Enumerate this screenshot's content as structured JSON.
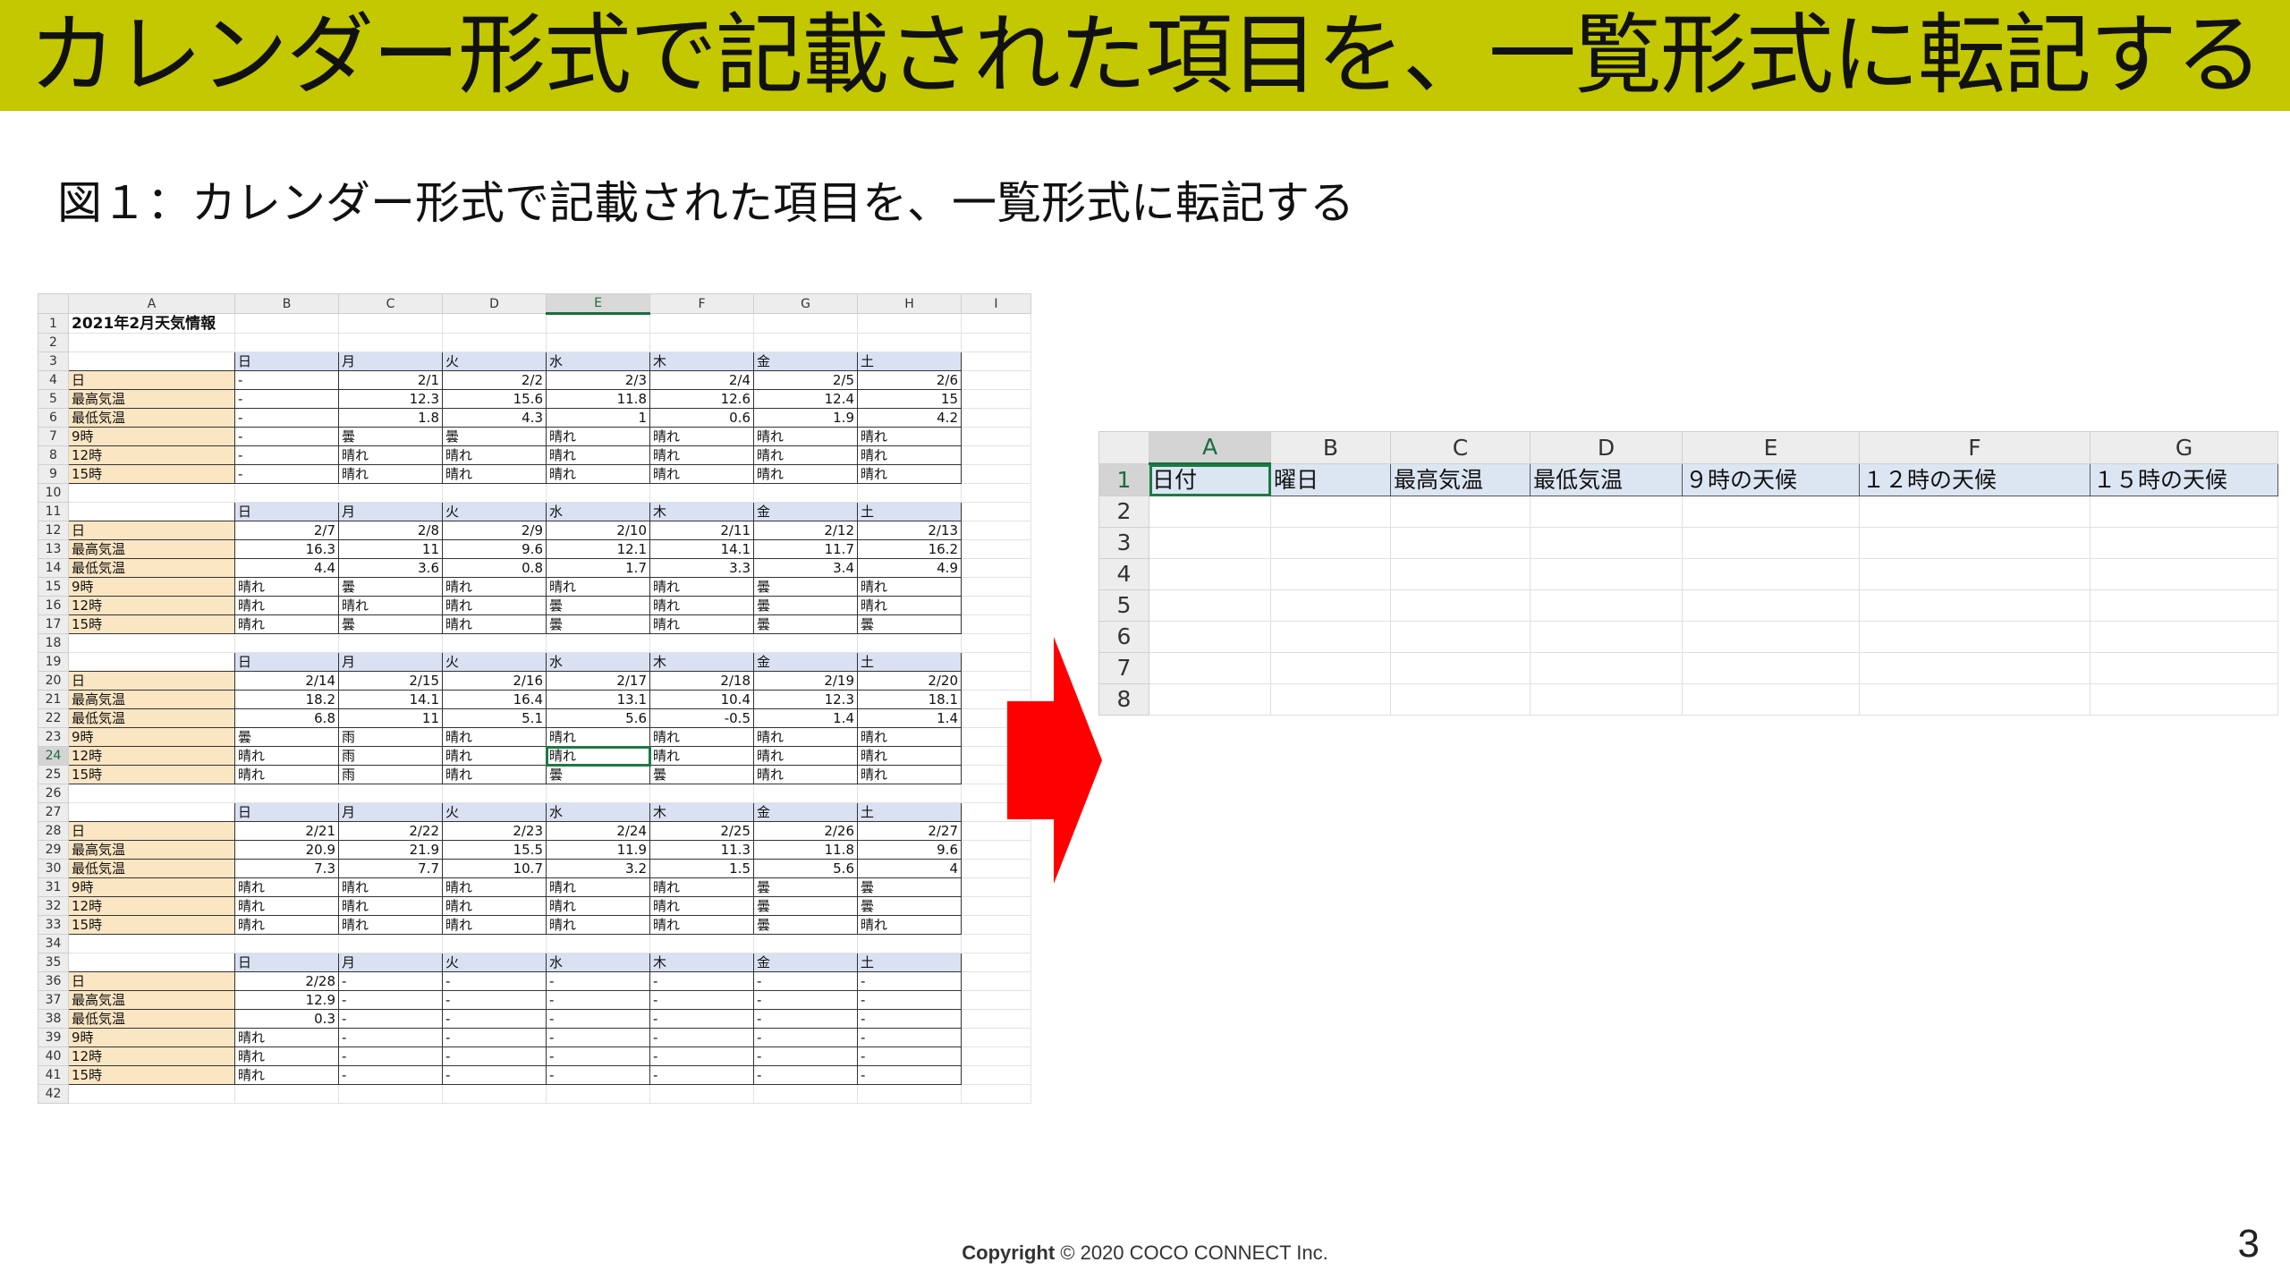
{
  "banner": {
    "title": "カレンダー形式で記載された項目を、一覧形式に転記する",
    "color": "#c3c800"
  },
  "caption": "図１：カレンダー形式で記載された項目を、一覧形式に転記する",
  "left_sheet": {
    "columns": [
      "A",
      "B",
      "C",
      "D",
      "E",
      "F",
      "G",
      "H",
      "I"
    ],
    "selected_column": "E",
    "selected_row": 24,
    "title": "2021年2月天気情報",
    "weekdays": [
      "日",
      "月",
      "火",
      "水",
      "木",
      "金",
      "土"
    ],
    "row_labels": [
      "日",
      "最高気温",
      "最低気温",
      "9時",
      "12時",
      "15時"
    ],
    "weeks": [
      {
        "dates": [
          "-",
          "2/1",
          "2/2",
          "2/3",
          "2/4",
          "2/5",
          "2/6"
        ],
        "high": [
          "-",
          "12.3",
          "15.6",
          "11.8",
          "12.6",
          "12.4",
          "15"
        ],
        "low": [
          "-",
          "1.8",
          "4.3",
          "1",
          "0.6",
          "1.9",
          "4.2"
        ],
        "w9": [
          "-",
          "曇",
          "曇",
          "晴れ",
          "晴れ",
          "晴れ",
          "晴れ"
        ],
        "w12": [
          "-",
          "晴れ",
          "晴れ",
          "晴れ",
          "晴れ",
          "晴れ",
          "晴れ"
        ],
        "w15": [
          "-",
          "晴れ",
          "晴れ",
          "晴れ",
          "晴れ",
          "晴れ",
          "晴れ"
        ]
      },
      {
        "dates": [
          "2/7",
          "2/8",
          "2/9",
          "2/10",
          "2/11",
          "2/12",
          "2/13"
        ],
        "high": [
          "16.3",
          "11",
          "9.6",
          "12.1",
          "14.1",
          "11.7",
          "16.2"
        ],
        "low": [
          "4.4",
          "3.6",
          "0.8",
          "1.7",
          "3.3",
          "3.4",
          "4.9"
        ],
        "w9": [
          "晴れ",
          "曇",
          "晴れ",
          "晴れ",
          "晴れ",
          "曇",
          "晴れ"
        ],
        "w12": [
          "晴れ",
          "晴れ",
          "晴れ",
          "曇",
          "晴れ",
          "曇",
          "晴れ"
        ],
        "w15": [
          "晴れ",
          "曇",
          "晴れ",
          "曇",
          "晴れ",
          "曇",
          "曇"
        ]
      },
      {
        "dates": [
          "2/14",
          "2/15",
          "2/16",
          "2/17",
          "2/18",
          "2/19",
          "2/20"
        ],
        "high": [
          "18.2",
          "14.1",
          "16.4",
          "13.1",
          "10.4",
          "12.3",
          "18.1"
        ],
        "low": [
          "6.8",
          "11",
          "5.1",
          "5.6",
          "-0.5",
          "1.4",
          "1.4"
        ],
        "w9": [
          "曇",
          "雨",
          "晴れ",
          "晴れ",
          "晴れ",
          "晴れ",
          "晴れ"
        ],
        "w12": [
          "晴れ",
          "雨",
          "晴れ",
          "晴れ",
          "晴れ",
          "晴れ",
          "晴れ"
        ],
        "w15": [
          "晴れ",
          "雨",
          "晴れ",
          "曇",
          "曇",
          "晴れ",
          "晴れ"
        ]
      },
      {
        "dates": [
          "2/21",
          "2/22",
          "2/23",
          "2/24",
          "2/25",
          "2/26",
          "2/27"
        ],
        "high": [
          "20.9",
          "21.9",
          "15.5",
          "11.9",
          "11.3",
          "11.8",
          "9.6"
        ],
        "low": [
          "7.3",
          "7.7",
          "10.7",
          "3.2",
          "1.5",
          "5.6",
          "4"
        ],
        "w9": [
          "晴れ",
          "晴れ",
          "晴れ",
          "晴れ",
          "晴れ",
          "曇",
          "曇"
        ],
        "w12": [
          "晴れ",
          "晴れ",
          "晴れ",
          "晴れ",
          "晴れ",
          "曇",
          "曇"
        ],
        "w15": [
          "晴れ",
          "晴れ",
          "晴れ",
          "晴れ",
          "晴れ",
          "曇",
          "晴れ"
        ]
      },
      {
        "dates": [
          "2/28",
          "-",
          "-",
          "-",
          "-",
          "-",
          "-"
        ],
        "high": [
          "12.9",
          "-",
          "-",
          "-",
          "-",
          "-",
          "-"
        ],
        "low": [
          "0.3",
          "-",
          "-",
          "-",
          "-",
          "-",
          "-"
        ],
        "w9": [
          "晴れ",
          "-",
          "-",
          "-",
          "-",
          "-",
          "-"
        ],
        "w12": [
          "晴れ",
          "-",
          "-",
          "-",
          "-",
          "-",
          "-"
        ],
        "w15": [
          "晴れ",
          "-",
          "-",
          "-",
          "-",
          "-",
          "-"
        ]
      }
    ],
    "total_rows": 42
  },
  "arrow": {
    "color": "#ff0000"
  },
  "right_sheet": {
    "columns": [
      "A",
      "B",
      "C",
      "D",
      "E",
      "F",
      "G"
    ],
    "selected_column": "A",
    "headers": [
      "日付",
      "曜日",
      "最高気温",
      "最低気温",
      "９時の天候",
      "１２時の天候",
      "１５時の天候"
    ],
    "row_numbers": [
      "1",
      "2",
      "3",
      "4",
      "5",
      "6",
      "7",
      "8"
    ]
  },
  "footer": {
    "copyright_word": "Copyright",
    "rest": " © 2020 COCO CONNECT Inc."
  },
  "page_number": "3"
}
